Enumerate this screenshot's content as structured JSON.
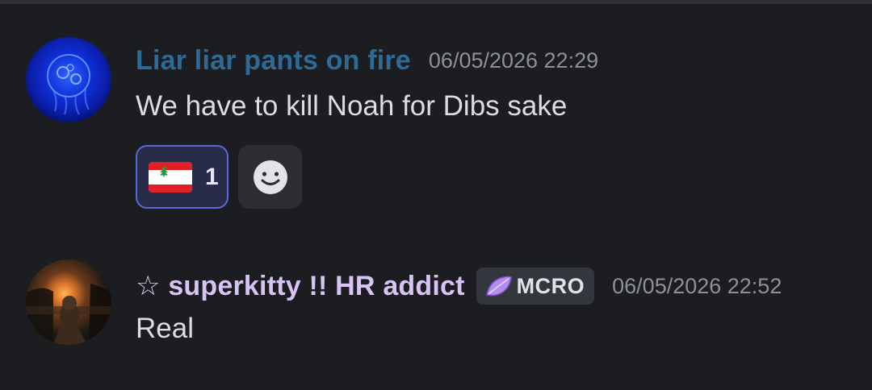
{
  "messages": [
    {
      "avatar_icon": "jellyfish-avatar",
      "username": "Liar liar pants on fire",
      "username_color": "#2e6a96",
      "timestamp": "06/05/2026 22:29",
      "text": "We have to kill Noah for Dibs sake",
      "reactions": [
        {
          "emoji_icon": "lebanon-flag-icon",
          "count": "1",
          "active": true
        }
      ],
      "add_reaction_icon": "smiley-face-icon"
    },
    {
      "avatar_icon": "sunset-photo-avatar",
      "username": "☆ superkitty !! HR addict",
      "username_color": "#d8c4f4",
      "tag": {
        "icon": "purple-leaf-icon",
        "label": "MCRO"
      },
      "timestamp": "06/05/2026 22:52",
      "text": "Real"
    }
  ],
  "colors": {
    "background": "#1c1d21",
    "reaction_active_bg": "#292c48",
    "reaction_active_border": "#5b68d6",
    "timestamp": "#8e9099",
    "message_text": "#dcdde1"
  }
}
